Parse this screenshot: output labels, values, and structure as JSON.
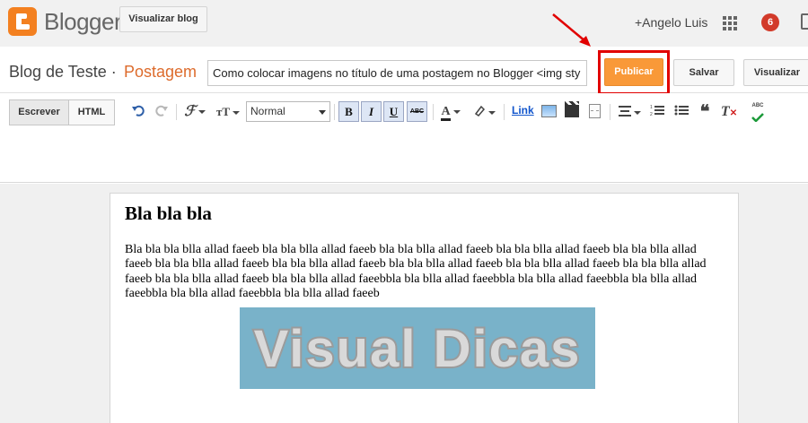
{
  "topbar": {
    "brand": "Blogger",
    "view_blog_label": "Visualizar blog",
    "user": "+Angelo Luis",
    "notifications": "6"
  },
  "post_header": {
    "blog_name": "Blog de Teste ·",
    "section": "Postagem",
    "title_value": "Como colocar imagens no título de uma postagem no Blogger <img sty",
    "publish_label": "Publicar",
    "save_label": "Salvar",
    "preview_label": "Visualizar"
  },
  "toolbar": {
    "mode_write": "Escrever",
    "mode_html": "HTML",
    "format_value": "Normal",
    "bold": "B",
    "italic": "I",
    "underline": "U",
    "strike": "ABC",
    "link": "Link",
    "spell": "ABC"
  },
  "post": {
    "heading": "Bla bla bla",
    "body": "Bla bla bla blla allad faeeb bla bla blla allad faeeb bla bla blla allad faeeb bla bla blla allad faeeb bla bla blla allad faeeb bla bla blla allad faeeb bla bla blla allad faeeb bla bla blla allad faeeb bla bla blla allad faeeb bla bla blla allad faeeb bla bla blla allad faeeb bla bla blla allad faeebbla bla blla allad faeebbla bla blla allad faeebbla bla blla allad faeebbla bla blla allad faeebbla bla blla allad faeeb",
    "image_text": "Visual Dicas"
  },
  "colors": {
    "accent_orange": "#f99938",
    "annotation_red": "#e10000",
    "image_bg": "#79b2c9"
  }
}
